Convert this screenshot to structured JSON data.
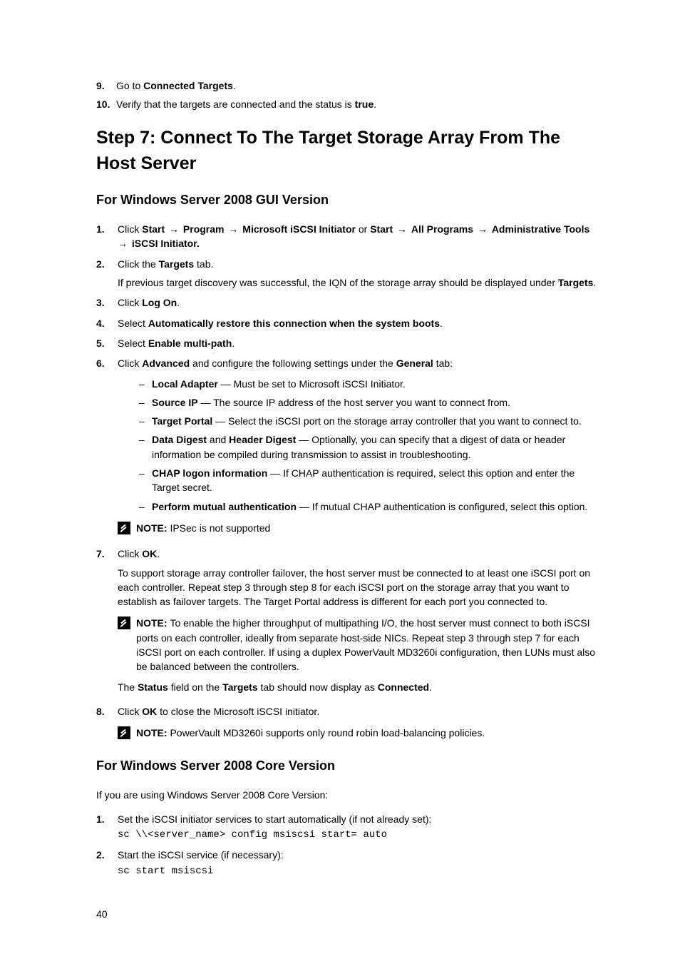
{
  "intro_steps": [
    {
      "num": "9.",
      "pre": "Go to ",
      "bold": "Connected Targets",
      "post": "."
    },
    {
      "num": "10.",
      "pre": "Verify that the targets are connected and the status is ",
      "bold": "true",
      "post": "."
    }
  ],
  "h1": "Step 7: Connect To The Target Storage Array From The Host Server",
  "gui": {
    "heading": "For Windows Server 2008 GUI Version",
    "s1": {
      "num": "1.",
      "click": "Click ",
      "start": "Start",
      "arrow": " → ",
      "program": "Program",
      "msi": "Microsoft iSCSI Initiator",
      "or": " or ",
      "start2": "Start",
      "allprog": "All Programs",
      "admintools": "Administrative Tools",
      "iscsi": "iSCSI Initiator."
    },
    "s2": {
      "num": "2.",
      "line1a": "Click the ",
      "line1b": "Targets",
      "line1c": " tab.",
      "line2a": "If previous target discovery was successful, the IQN of the storage array should be displayed under ",
      "line2b": "Targets",
      "line2c": "."
    },
    "s3": {
      "num": "3.",
      "a": "Click ",
      "b": "Log On",
      "c": "."
    },
    "s4": {
      "num": "4.",
      "a": "Select ",
      "b": "Automatically restore this connection when the system boots",
      "c": "."
    },
    "s5": {
      "num": "5.",
      "a": "Select ",
      "b": "Enable multi-path",
      "c": "."
    },
    "s6": {
      "num": "6.",
      "a": "Click ",
      "b": "Advanced",
      "c": " and configure the following settings under the ",
      "d": "General",
      "e": " tab:",
      "items": [
        {
          "b": "Local Adapter",
          "t": " — Must be set to Microsoft iSCSI Initiator."
        },
        {
          "b": "Source IP",
          "t": " — The source IP address of the host server you want to connect from."
        },
        {
          "b": "Target Portal",
          "t": " — Select the iSCSI port on the storage array controller that you want to connect to."
        },
        {
          "b": "Data Digest",
          "mid": " and ",
          "b2": "Header Digest",
          "t": " — Optionally, you can specify that a digest of data or header information be compiled during transmission to assist in troubleshooting."
        },
        {
          "b": "CHAP logon information",
          "t": " — If CHAP authentication is required, select this option and enter the Target secret."
        },
        {
          "b": "Perform mutual authentication",
          "t": " — If mutual CHAP authentication is configured, select this option."
        }
      ],
      "note": {
        "label": "NOTE: ",
        "text": "IPSec is not supported"
      }
    },
    "s7": {
      "num": "7.",
      "a": "Click ",
      "b": "OK",
      "c": ".",
      "p1": "To support storage array controller failover, the host server must be connected to at least one iSCSI port on each controller. Repeat step 3 through step 8 for each iSCSI port on the storage array that you want to establish as failover targets. The Target Portal address is different for each port you connected to.",
      "note": {
        "label": "NOTE: ",
        "text": "To enable the higher throughput of multipathing I/O, the host server must connect to both iSCSI ports on each controller, ideally from separate host-side NICs. Repeat step 3 through step 7 for each iSCSI port on each controller. If using a duplex PowerVault MD3260i configuration, then LUNs must also be balanced between the controllers."
      },
      "p2a": "The ",
      "p2b": "Status",
      "p2c": " field on the ",
      "p2d": "Targets",
      "p2e": " tab should now display as ",
      "p2f": "Connected",
      "p2g": "."
    },
    "s8": {
      "num": "8.",
      "a": "Click ",
      "b": "OK",
      "c": " to close the Microsoft iSCSI initiator.",
      "note": {
        "label": "NOTE: ",
        "text": "PowerVault MD3260i supports only round robin load-balancing policies."
      }
    }
  },
  "core": {
    "heading": "For Windows Server 2008 Core Version",
    "intro": "If you are using Windows Server 2008 Core Version:",
    "s1": {
      "num": "1.",
      "text": "Set the iSCSI initiator services to start automatically (if not already set):",
      "code": "sc \\\\<server_name> config msiscsi start= auto"
    },
    "s2": {
      "num": "2.",
      "text": "Start the iSCSI service (if necessary):",
      "code": "sc start msiscsi"
    }
  },
  "page": "40"
}
